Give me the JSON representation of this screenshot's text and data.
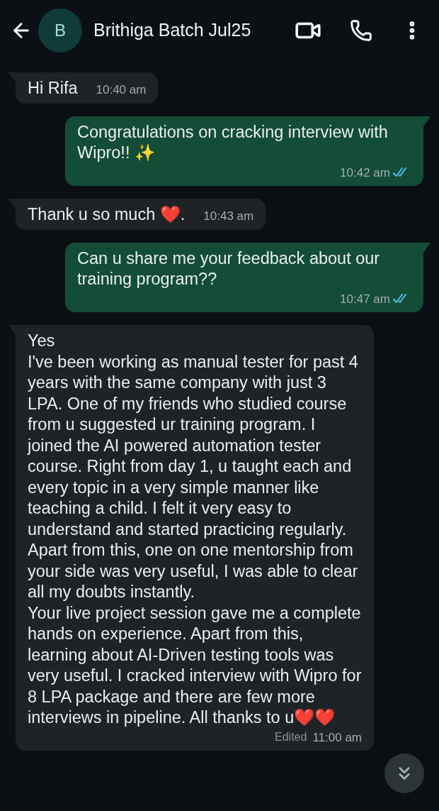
{
  "header": {
    "avatar_letter": "B",
    "title": "Brithiga Batch Jul25"
  },
  "messages": [
    {
      "kind": "incoming",
      "text": "Hi Rifa",
      "time": "10:40 am",
      "tail": true
    },
    {
      "kind": "outgoing",
      "text": "Congratulations on cracking interview with Wipro!! ✨",
      "time": "10:42 am",
      "read": true,
      "tail": true
    },
    {
      "kind": "incoming",
      "text": "Thank u so much ❤️.",
      "time": "10:43 am",
      "tail": true
    },
    {
      "kind": "outgoing",
      "text": "Can u share me your feedback about our training program??",
      "time": "10:47 am",
      "read": true,
      "tail": true
    },
    {
      "kind": "incoming",
      "text": "Yes\nI've been working as manual tester for past 4 years with the same company with just 3 LPA. One of my friends who studied course from u suggested ur training program. I joined the AI powered automation tester course. Right from day 1, u taught each and every topic in a very simple manner like teaching a child. I felt it very easy to understand and started practicing regularly. Apart from this, one on one mentorship from your side was very useful, I was able to clear all my doubts instantly.\nYour live project session gave me a complete hands on experience. Apart from this, learning about AI-Driven testing tools was very useful. I cracked interview with Wipro for 8 LPA package and there are few more interviews in pipeline. All thanks to u❤️❤️",
      "time": "11:00 am",
      "edited": "Edited",
      "tail": true
    }
  ]
}
